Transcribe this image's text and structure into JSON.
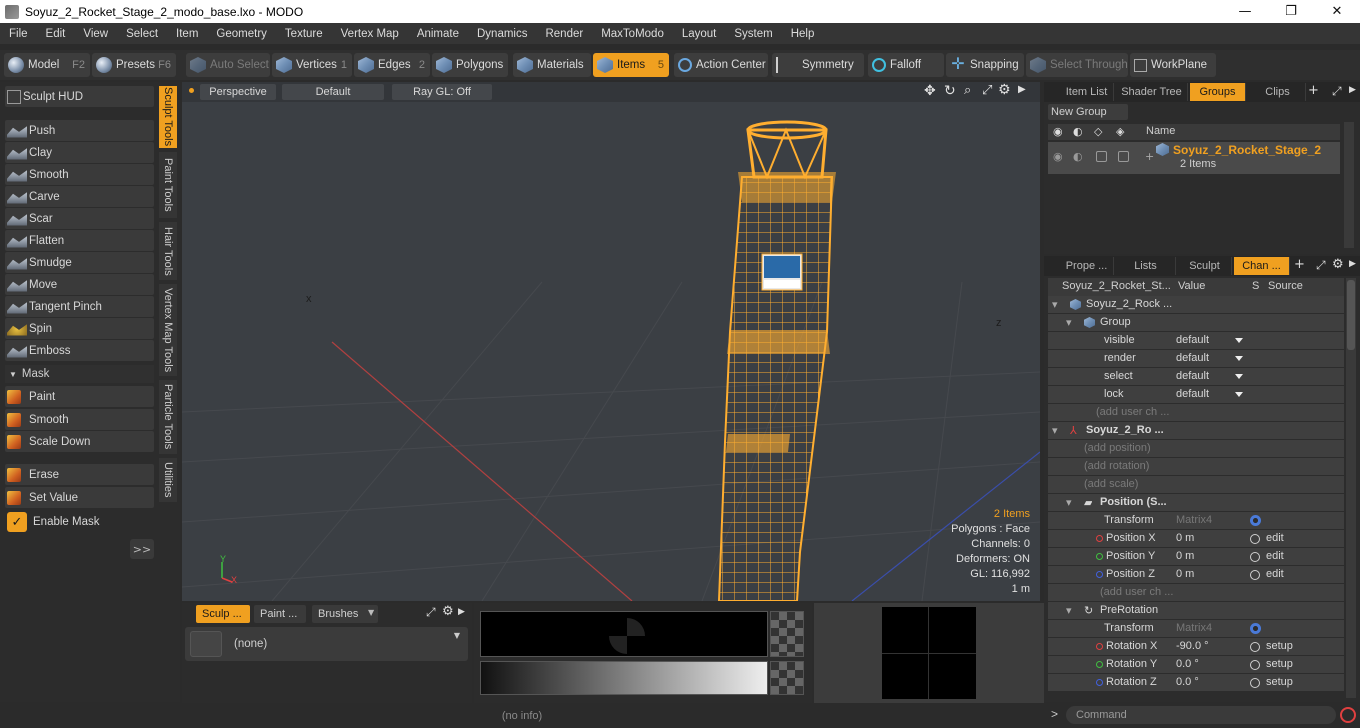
{
  "window": {
    "title": "Soyuz_2_Rocket_Stage_2_modo_base.lxo - MODO",
    "minimize": "—",
    "maximize": "❐",
    "close": "✕"
  },
  "menu": [
    "File",
    "Edit",
    "View",
    "Select",
    "Item",
    "Geometry",
    "Texture",
    "Vertex Map",
    "Animate",
    "Dynamics",
    "Render",
    "MaxToModo",
    "Layout",
    "System",
    "Help"
  ],
  "toolbar": {
    "model": "Model",
    "model_key": "F2",
    "presets": "Presets",
    "presets_key": "F6",
    "auto_select": "Auto Select",
    "vertices": "Vertices",
    "vertices_key": "1",
    "edges": "Edges",
    "edges_key": "2",
    "polygons": "Polygons",
    "materials": "Materials",
    "items": "Items",
    "items_key": "5",
    "action_center": "Action Center",
    "symmetry": "Symmetry",
    "falloff": "Falloff",
    "snapping": "Snapping",
    "select_through": "Select Through",
    "workplane": "WorkPlane"
  },
  "sculpt": {
    "hud": "Sculpt HUD",
    "tools": [
      "Push",
      "Clay",
      "Smooth",
      "Carve",
      "Scar",
      "Flatten",
      "Smudge",
      "Move",
      "Tangent Pinch",
      "Spin",
      "Emboss"
    ],
    "mask_header": "Mask",
    "mask_tools": [
      "Paint",
      "Smooth",
      "Scale Down"
    ],
    "erase": "Erase",
    "set_value": "Set Value",
    "enable_mask": "Enable Mask",
    "more": ">>",
    "vtabs": [
      "Sculpt Tools",
      "Paint Tools",
      "Hair Tools",
      "Vertex Map Tools",
      "Particle Tools",
      "Utilities"
    ]
  },
  "viewport": {
    "view": "Perspective",
    "style": "Default",
    "raygl": "Ray GL: Off",
    "info": {
      "items": "2 Items",
      "polygons": "Polygons : Face",
      "channels": "Channels: 0",
      "deformers": "Deformers: ON",
      "gl": "GL: 116,992",
      "unit": "1 m"
    },
    "axis_x": "X",
    "axis_y": "Y",
    "axis_z": "Z"
  },
  "tool_presets": {
    "tabs": [
      "Sculp ...",
      "Paint ...",
      "Brushes"
    ],
    "dropdown": "(none)"
  },
  "items_panel": {
    "tabs": [
      "Item List",
      "Shader Tree",
      "Groups",
      "Clips"
    ],
    "new_group": "New Group",
    "name_col": "Name",
    "group_name": "Soyuz_2_Rocket_Stage_2",
    "group_count": "2 Items"
  },
  "channels_panel": {
    "tabs": [
      "Prope ...",
      "Lists",
      "Sculpt",
      "Chan ..."
    ],
    "header": {
      "name": "Soyuz_2_Rocket_St...",
      "value": "Value",
      "s": "S",
      "source": "Source"
    },
    "rows": [
      {
        "name": "Soyuz_2_Rock ...",
        "value": "",
        "source": ""
      },
      {
        "name": "Group",
        "value": "",
        "source": ""
      },
      {
        "name": "visible",
        "value": "default",
        "source": ""
      },
      {
        "name": "render",
        "value": "default",
        "source": ""
      },
      {
        "name": "select",
        "value": "default",
        "source": ""
      },
      {
        "name": "lock",
        "value": "default",
        "source": ""
      },
      {
        "name": "(add user ch ...",
        "value": "",
        "source": ""
      },
      {
        "name": "Soyuz_2_Ro ...",
        "value": "",
        "source": ""
      },
      {
        "name": "(add position)",
        "value": "",
        "source": ""
      },
      {
        "name": "(add rotation)",
        "value": "",
        "source": ""
      },
      {
        "name": "(add scale)",
        "value": "",
        "source": ""
      },
      {
        "name": "Position (S...",
        "value": "",
        "source": ""
      },
      {
        "name": "Transform",
        "value": "Matrix4",
        "source": ""
      },
      {
        "name": "Position X",
        "value": "0 m",
        "source": "edit"
      },
      {
        "name": "Position Y",
        "value": "0 m",
        "source": "edit"
      },
      {
        "name": "Position Z",
        "value": "0 m",
        "source": "edit"
      },
      {
        "name": "(add user ch ...",
        "value": "",
        "source": ""
      },
      {
        "name": "PreRotation",
        "value": "",
        "source": ""
      },
      {
        "name": "Transform",
        "value": "Matrix4",
        "source": ""
      },
      {
        "name": "Rotation X",
        "value": "-90.0 °",
        "source": "setup"
      },
      {
        "name": "Rotation Y",
        "value": "0.0 °",
        "source": "setup"
      },
      {
        "name": "Rotation Z",
        "value": "0.0 °",
        "source": "setup"
      }
    ]
  },
  "status": {
    "info": "(no info)",
    "command_placeholder": "Command",
    "prompt": ">"
  },
  "colors": {
    "accent": "#f0a020",
    "viewport_bg": "#3b3f44",
    "panel_bg": "#2c2c2c",
    "x_axis": "#e04040",
    "y_axis": "#40c040",
    "z_axis": "#4060e0"
  }
}
